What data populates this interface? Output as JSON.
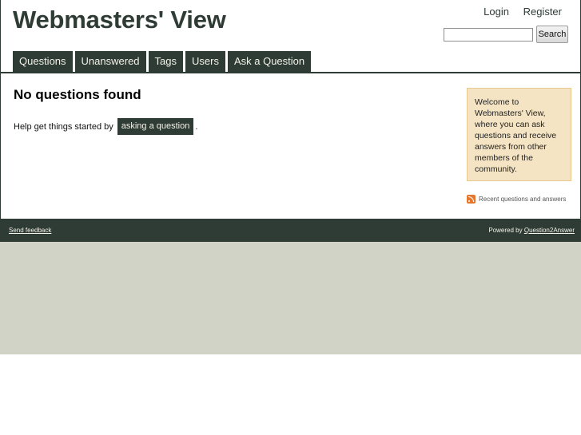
{
  "site": {
    "title": "Webmasters' View"
  },
  "user_nav": {
    "login": "Login",
    "register": "Register"
  },
  "search": {
    "value": "",
    "button_label": "Search"
  },
  "nav": {
    "tabs": [
      {
        "label": "Questions"
      },
      {
        "label": "Unanswered"
      },
      {
        "label": "Tags"
      },
      {
        "label": "Users"
      },
      {
        "label": "Ask a Question"
      }
    ]
  },
  "main": {
    "title": "No questions found",
    "help_prefix": "Help get things started by",
    "help_link": "asking a question",
    "help_suffix": "."
  },
  "sidebar": {
    "welcome": "Welcome to Webmasters' View, where you can ask questions and receive answers from other members of the community.",
    "feed_label": "Recent questions and answers"
  },
  "footer": {
    "feedback": "Send feedback",
    "powered_by": "Powered by",
    "powered_link": "Question2Answer"
  },
  "colors": {
    "primary": "#2f3b35",
    "page_bg": "#d1d3c6",
    "welcome_bg": "#f5e4c3",
    "rss": "#e8772e"
  }
}
